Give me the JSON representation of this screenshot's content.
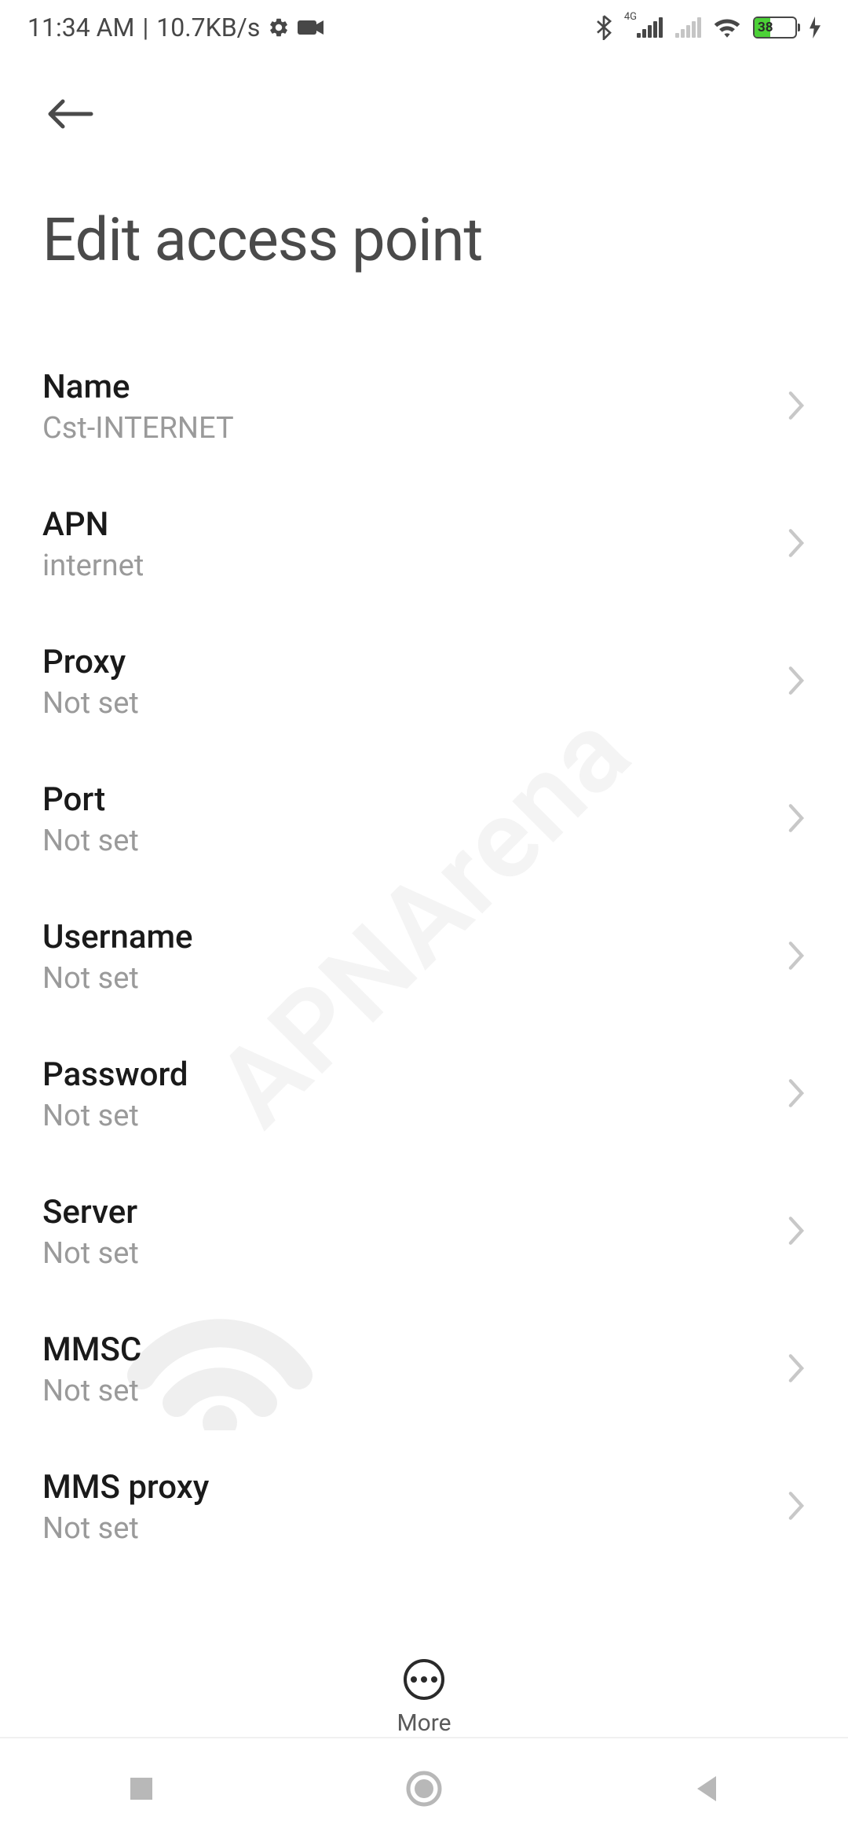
{
  "statusbar": {
    "time": "11:34 AM",
    "speed": "10.7KB/s",
    "network_type": "4G",
    "battery_level": "38"
  },
  "page": {
    "title": "Edit access point"
  },
  "items": [
    {
      "label": "Name",
      "value": "Cst-INTERNET"
    },
    {
      "label": "APN",
      "value": "internet"
    },
    {
      "label": "Proxy",
      "value": "Not set"
    },
    {
      "label": "Port",
      "value": "Not set"
    },
    {
      "label": "Username",
      "value": "Not set"
    },
    {
      "label": "Password",
      "value": "Not set"
    },
    {
      "label": "Server",
      "value": "Not set"
    },
    {
      "label": "MMSC",
      "value": "Not set"
    },
    {
      "label": "MMS proxy",
      "value": "Not set"
    }
  ],
  "bottombar": {
    "more_label": "More"
  },
  "watermark": "APNArena"
}
